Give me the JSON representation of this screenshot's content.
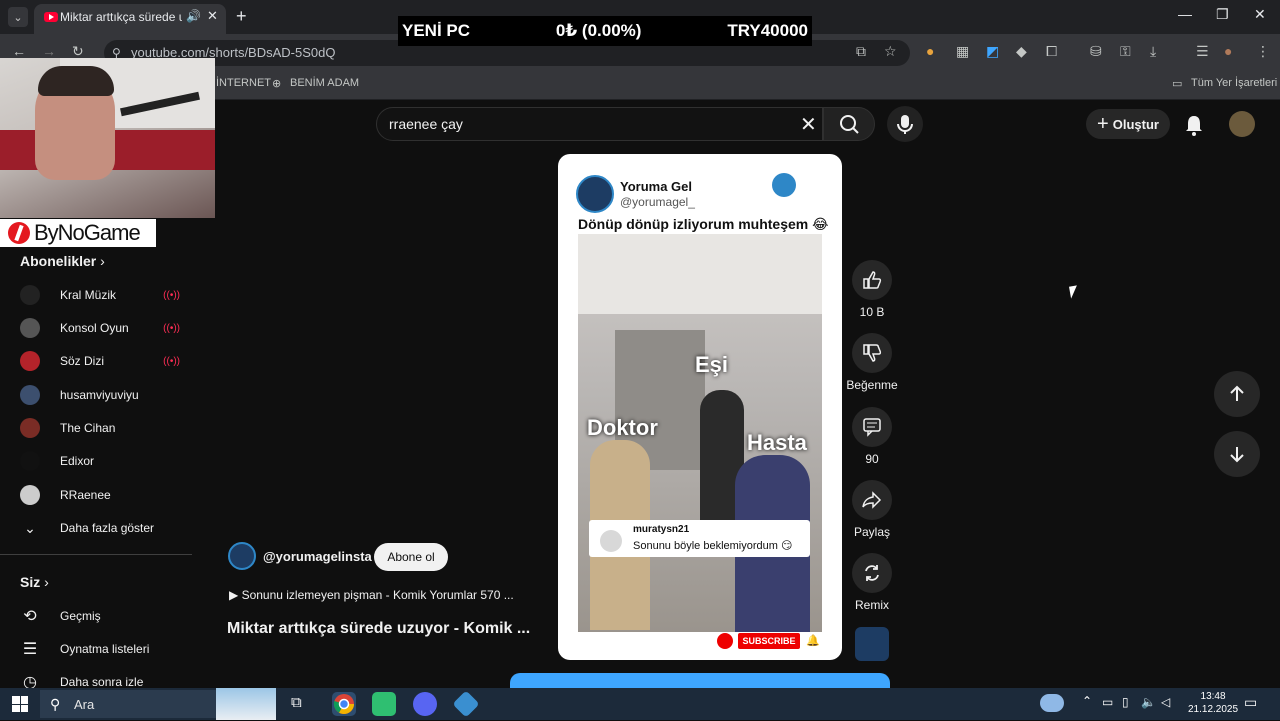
{
  "browser": {
    "tab_title": "Miktar arttıkça sürede uzuyo",
    "url": "youtube.com/shorts/BDsAD-5S0dQ",
    "bookmarks": [
      "İNTERNET",
      "BENİM ADAM"
    ],
    "all_bookmarks": "Tüm Yer İşaretleri"
  },
  "ticker": {
    "name": "YENİ PC",
    "change": "0₺ (0.00%)",
    "goal": "TRY40000"
  },
  "webcam": {
    "brand": "ByNoGame"
  },
  "youtube": {
    "search_value": "rraenee çay",
    "create_label": "Oluştur",
    "subscriptions_header": "Abonelikler",
    "subscriptions": [
      {
        "label": "Kral Müzik",
        "color": "#222222",
        "live": true
      },
      {
        "label": "Konsol Oyun",
        "color": "#555555",
        "live": true
      },
      {
        "label": "Söz Dizi",
        "color": "#b4232a",
        "live": true
      },
      {
        "label": "husamviyuviyu",
        "color": "#3c4f6e",
        "live": false
      },
      {
        "label": "The Cihan",
        "color": "#7a2c25",
        "live": false
      },
      {
        "label": "Edixor",
        "color": "#111111",
        "live": false
      },
      {
        "label": "RRaenee",
        "color": "#cccccc",
        "live": false
      }
    ],
    "show_more": "Daha fazla göster",
    "you_header": "Siz",
    "you_items": [
      "Geçmiş",
      "Oynatma listeleri",
      "Daha sonra izle"
    ]
  },
  "short": {
    "card_name": "Yoruma Gel",
    "card_handle": "@yorumagel_",
    "caption": "Dönüp dönüp izliyorum muhteşem 😂",
    "overlay_labels": [
      "Eşi",
      "Doktor",
      "Hasta"
    ],
    "comment_user": "muratysn21",
    "comment_text": "Sonunu böyle beklemiyordum 😏",
    "subscribe_badge": "SUBSCRIBE",
    "channel_handle": "@yorumagelinsta",
    "subscribe_label": "Abone ol",
    "music": "▶ Sonunu izlemeyen pişman - Komik Yorumlar 570 ...",
    "title": "Miktar arttıkça sürede uzuyor - Komik ..."
  },
  "actions": {
    "likes": "10 B",
    "dislike": "Beğenme",
    "comments": "90",
    "share": "Paylaş",
    "remix": "Remix"
  },
  "taskbar": {
    "search_placeholder": "Ara",
    "time": "13:48",
    "date": "21.12.2025"
  }
}
